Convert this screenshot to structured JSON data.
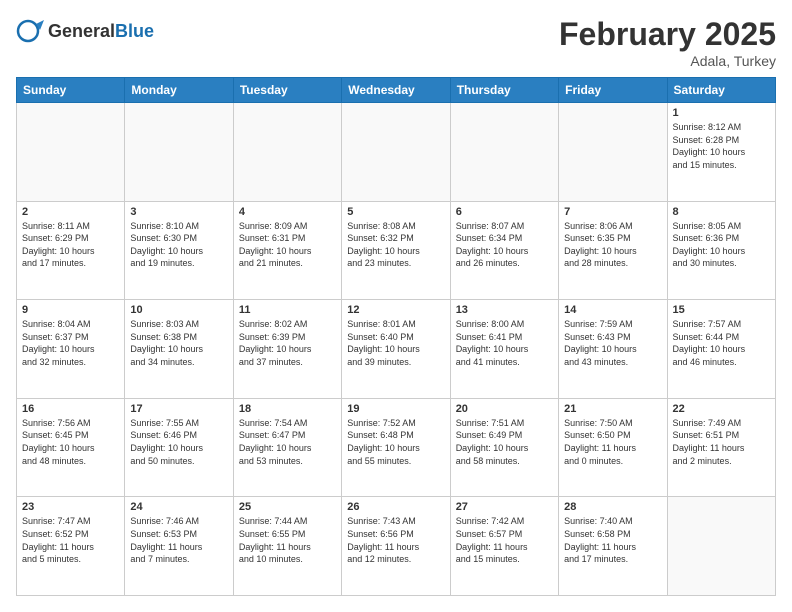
{
  "header": {
    "logo_general": "General",
    "logo_blue": "Blue",
    "month_title": "February 2025",
    "location": "Adala, Turkey"
  },
  "days_of_week": [
    "Sunday",
    "Monday",
    "Tuesday",
    "Wednesday",
    "Thursday",
    "Friday",
    "Saturday"
  ],
  "weeks": [
    [
      {
        "day": "",
        "info": ""
      },
      {
        "day": "",
        "info": ""
      },
      {
        "day": "",
        "info": ""
      },
      {
        "day": "",
        "info": ""
      },
      {
        "day": "",
        "info": ""
      },
      {
        "day": "",
        "info": ""
      },
      {
        "day": "1",
        "info": "Sunrise: 8:12 AM\nSunset: 6:28 PM\nDaylight: 10 hours\nand 15 minutes."
      }
    ],
    [
      {
        "day": "2",
        "info": "Sunrise: 8:11 AM\nSunset: 6:29 PM\nDaylight: 10 hours\nand 17 minutes."
      },
      {
        "day": "3",
        "info": "Sunrise: 8:10 AM\nSunset: 6:30 PM\nDaylight: 10 hours\nand 19 minutes."
      },
      {
        "day": "4",
        "info": "Sunrise: 8:09 AM\nSunset: 6:31 PM\nDaylight: 10 hours\nand 21 minutes."
      },
      {
        "day": "5",
        "info": "Sunrise: 8:08 AM\nSunset: 6:32 PM\nDaylight: 10 hours\nand 23 minutes."
      },
      {
        "day": "6",
        "info": "Sunrise: 8:07 AM\nSunset: 6:34 PM\nDaylight: 10 hours\nand 26 minutes."
      },
      {
        "day": "7",
        "info": "Sunrise: 8:06 AM\nSunset: 6:35 PM\nDaylight: 10 hours\nand 28 minutes."
      },
      {
        "day": "8",
        "info": "Sunrise: 8:05 AM\nSunset: 6:36 PM\nDaylight: 10 hours\nand 30 minutes."
      }
    ],
    [
      {
        "day": "9",
        "info": "Sunrise: 8:04 AM\nSunset: 6:37 PM\nDaylight: 10 hours\nand 32 minutes."
      },
      {
        "day": "10",
        "info": "Sunrise: 8:03 AM\nSunset: 6:38 PM\nDaylight: 10 hours\nand 34 minutes."
      },
      {
        "day": "11",
        "info": "Sunrise: 8:02 AM\nSunset: 6:39 PM\nDaylight: 10 hours\nand 37 minutes."
      },
      {
        "day": "12",
        "info": "Sunrise: 8:01 AM\nSunset: 6:40 PM\nDaylight: 10 hours\nand 39 minutes."
      },
      {
        "day": "13",
        "info": "Sunrise: 8:00 AM\nSunset: 6:41 PM\nDaylight: 10 hours\nand 41 minutes."
      },
      {
        "day": "14",
        "info": "Sunrise: 7:59 AM\nSunset: 6:43 PM\nDaylight: 10 hours\nand 43 minutes."
      },
      {
        "day": "15",
        "info": "Sunrise: 7:57 AM\nSunset: 6:44 PM\nDaylight: 10 hours\nand 46 minutes."
      }
    ],
    [
      {
        "day": "16",
        "info": "Sunrise: 7:56 AM\nSunset: 6:45 PM\nDaylight: 10 hours\nand 48 minutes."
      },
      {
        "day": "17",
        "info": "Sunrise: 7:55 AM\nSunset: 6:46 PM\nDaylight: 10 hours\nand 50 minutes."
      },
      {
        "day": "18",
        "info": "Sunrise: 7:54 AM\nSunset: 6:47 PM\nDaylight: 10 hours\nand 53 minutes."
      },
      {
        "day": "19",
        "info": "Sunrise: 7:52 AM\nSunset: 6:48 PM\nDaylight: 10 hours\nand 55 minutes."
      },
      {
        "day": "20",
        "info": "Sunrise: 7:51 AM\nSunset: 6:49 PM\nDaylight: 10 hours\nand 58 minutes."
      },
      {
        "day": "21",
        "info": "Sunrise: 7:50 AM\nSunset: 6:50 PM\nDaylight: 11 hours\nand 0 minutes."
      },
      {
        "day": "22",
        "info": "Sunrise: 7:49 AM\nSunset: 6:51 PM\nDaylight: 11 hours\nand 2 minutes."
      }
    ],
    [
      {
        "day": "23",
        "info": "Sunrise: 7:47 AM\nSunset: 6:52 PM\nDaylight: 11 hours\nand 5 minutes."
      },
      {
        "day": "24",
        "info": "Sunrise: 7:46 AM\nSunset: 6:53 PM\nDaylight: 11 hours\nand 7 minutes."
      },
      {
        "day": "25",
        "info": "Sunrise: 7:44 AM\nSunset: 6:55 PM\nDaylight: 11 hours\nand 10 minutes."
      },
      {
        "day": "26",
        "info": "Sunrise: 7:43 AM\nSunset: 6:56 PM\nDaylight: 11 hours\nand 12 minutes."
      },
      {
        "day": "27",
        "info": "Sunrise: 7:42 AM\nSunset: 6:57 PM\nDaylight: 11 hours\nand 15 minutes."
      },
      {
        "day": "28",
        "info": "Sunrise: 7:40 AM\nSunset: 6:58 PM\nDaylight: 11 hours\nand 17 minutes."
      },
      {
        "day": "",
        "info": ""
      }
    ]
  ]
}
